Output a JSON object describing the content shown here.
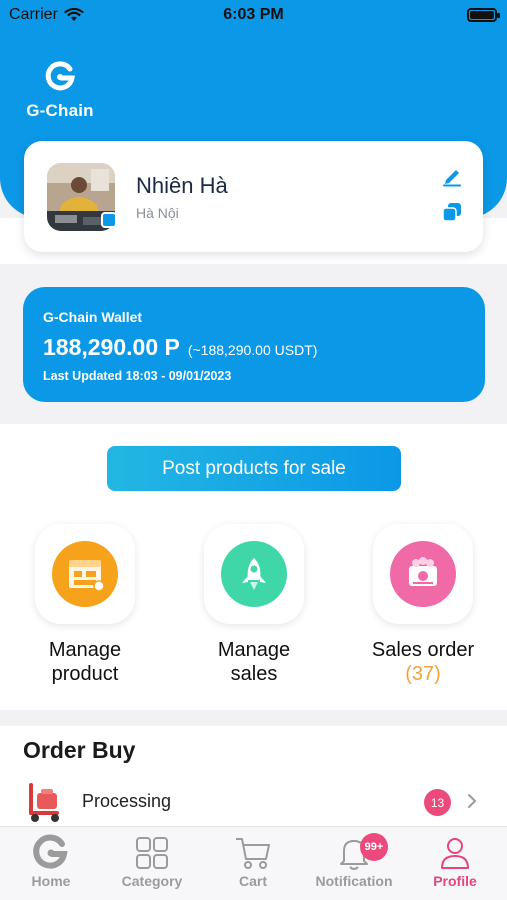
{
  "status_bar": {
    "carrier": "Carrier",
    "time": "6:03 PM"
  },
  "brand": {
    "name": "G-Chain"
  },
  "profile": {
    "name": "Nhiên Hà",
    "city": "Hà Nội"
  },
  "wallet": {
    "title": "G-Chain Wallet",
    "amount": "188,290.00 P",
    "usdt": "(~188,290.00 USDT)",
    "updated": "Last Updated 18:03 - 09/01/2023"
  },
  "post_button": "Post products for sale",
  "features": [
    {
      "label_line1": "Manage",
      "label_line2": "product",
      "icon": "store-icon"
    },
    {
      "label_line1": "Manage",
      "label_line2": "sales",
      "icon": "rocket-icon"
    },
    {
      "label_line1": "Sales order",
      "count": "(37)",
      "icon": "sales-order-icon"
    }
  ],
  "order_buy": {
    "title": "Order Buy",
    "rows": [
      {
        "label": "Processing",
        "badge": "13"
      }
    ]
  },
  "tabbar": {
    "items": [
      {
        "label": "Home"
      },
      {
        "label": "Category"
      },
      {
        "label": "Cart"
      },
      {
        "label": "Notification",
        "badge": "99+"
      },
      {
        "label": "Profile"
      }
    ],
    "active": "Profile"
  },
  "colors": {
    "primary": "#0b98e6",
    "accent_pink": "#ec4a7c",
    "count_orange": "#f0a33c"
  }
}
